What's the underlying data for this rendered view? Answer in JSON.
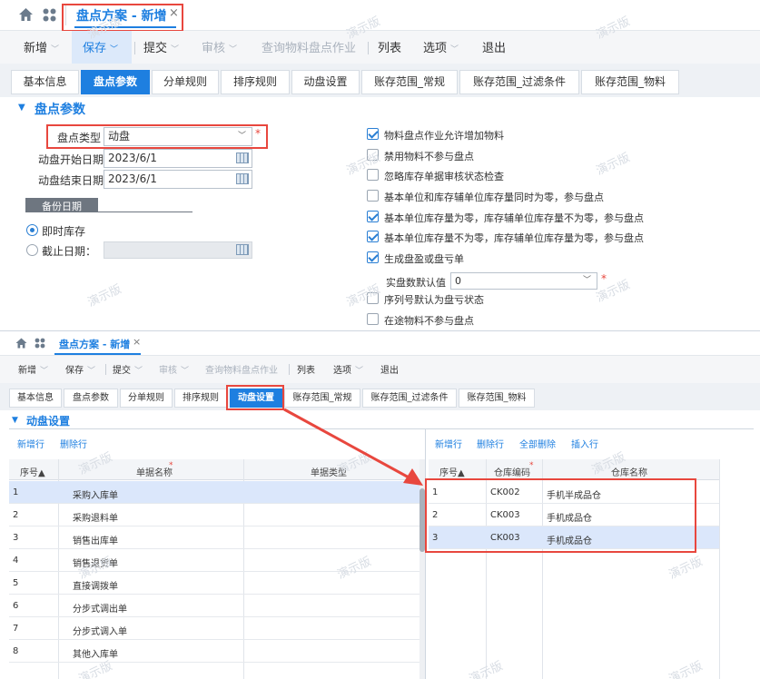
{
  "panel1": {
    "tab_title": "盘点方案 - 新增",
    "toolbar": [
      {
        "label": "新增",
        "dropdown": true,
        "disabled": false
      },
      {
        "label": "保存",
        "dropdown": true,
        "disabled": false
      },
      {
        "label": "提交",
        "dropdown": true,
        "disabled": false
      },
      {
        "label": "审核",
        "dropdown": true,
        "disabled": true
      },
      {
        "label": "查询物料盘点作业",
        "dropdown": false,
        "disabled": true
      },
      {
        "label": "列表",
        "dropdown": false,
        "disabled": false
      },
      {
        "label": "选项",
        "dropdown": true,
        "disabled": false
      },
      {
        "label": "退出",
        "dropdown": false,
        "disabled": false
      }
    ],
    "tabs": [
      "基本信息",
      "盘点参数",
      "分单规则",
      "排序规则",
      "动盘设置",
      "账存范围_常规",
      "账存范围_过滤条件",
      "账存范围_物料"
    ],
    "active_tab": "盘点参数",
    "section_title": "盘点参数",
    "form": {
      "count_type_label": "盘点类型",
      "count_type_value": "动盘",
      "start_date_label": "动盘开始日期",
      "start_date_value": "2023/6/1",
      "end_date_label": "动盘结束日期",
      "end_date_value": "2023/6/1",
      "backup_date_label": "备份日期",
      "radio_realtime": "即时库存",
      "radio_cutoff": "截止日期："
    },
    "checkboxes": [
      {
        "label": "物料盘点作业允许增加物料",
        "checked": true
      },
      {
        "label": "禁用物料不参与盘点",
        "checked": false
      },
      {
        "label": "忽略库存单据审核状态检查",
        "checked": false
      },
      {
        "label": "基本单位和库存辅单位库存量同时为零，参与盘点",
        "checked": false
      },
      {
        "label": "基本单位库存量为零，库存辅单位库存量不为零，参与盘点",
        "checked": true
      },
      {
        "label": "基本单位库存量不为零，库存辅单位库存量为零，参与盘点",
        "checked": true
      },
      {
        "label": "生成盘盈或盘亏单",
        "checked": true
      }
    ],
    "default_qty_label": "实盘数默认值",
    "default_qty_value": "0",
    "checkboxes_after": [
      {
        "label": "序列号默认为盘亏状态",
        "checked": false
      },
      {
        "label": "在途物料不参与盘点",
        "checked": false
      }
    ]
  },
  "panel2": {
    "tab_title": "盘点方案 - 新增",
    "toolbar": [
      {
        "label": "新增",
        "dropdown": true,
        "disabled": false
      },
      {
        "label": "保存",
        "dropdown": true,
        "disabled": false
      },
      {
        "label": "提交",
        "dropdown": true,
        "disabled": false
      },
      {
        "label": "审核",
        "dropdown": true,
        "disabled": true
      },
      {
        "label": "查询物料盘点作业",
        "dropdown": false,
        "disabled": true
      },
      {
        "label": "列表",
        "dropdown": false,
        "disabled": false
      },
      {
        "label": "选项",
        "dropdown": true,
        "disabled": false
      },
      {
        "label": "退出",
        "dropdown": false,
        "disabled": false
      }
    ],
    "tabs": [
      "基本信息",
      "盘点参数",
      "分单规则",
      "排序规则",
      "动盘设置",
      "账存范围_常规",
      "账存范围_过滤条件",
      "账存范围_物料"
    ],
    "active_tab": "动盘设置",
    "section_title": "动盘设置",
    "left_actions": [
      "新增行",
      "删除行"
    ],
    "left_headers": [
      "序号▲",
      "单据名称",
      "单据类型"
    ],
    "left_rows": [
      [
        "1",
        "采购入库单",
        ""
      ],
      [
        "2",
        "采购退料单",
        ""
      ],
      [
        "3",
        "销售出库单",
        ""
      ],
      [
        "4",
        "销售退货单",
        ""
      ],
      [
        "5",
        "直接调拨单",
        ""
      ],
      [
        "6",
        "分步式调出单",
        ""
      ],
      [
        "7",
        "分步式调入单",
        ""
      ],
      [
        "8",
        "其他入库单",
        ""
      ]
    ],
    "right_actions": [
      "新增行",
      "删除行",
      "全部删除",
      "插入行"
    ],
    "right_headers": [
      "序号▲",
      "仓库编码",
      "仓库名称"
    ],
    "right_rows": [
      [
        "1",
        "CK002",
        "手机半成品仓"
      ],
      [
        "2",
        "CK003",
        "手机成品仓"
      ],
      [
        "3",
        "CK003",
        "手机成品仓"
      ]
    ]
  },
  "watermark": "演示版",
  "colors": {
    "accent": "#1e7fe0",
    "highlight": "#e8473e",
    "selected_row": "#dbe7fb"
  }
}
